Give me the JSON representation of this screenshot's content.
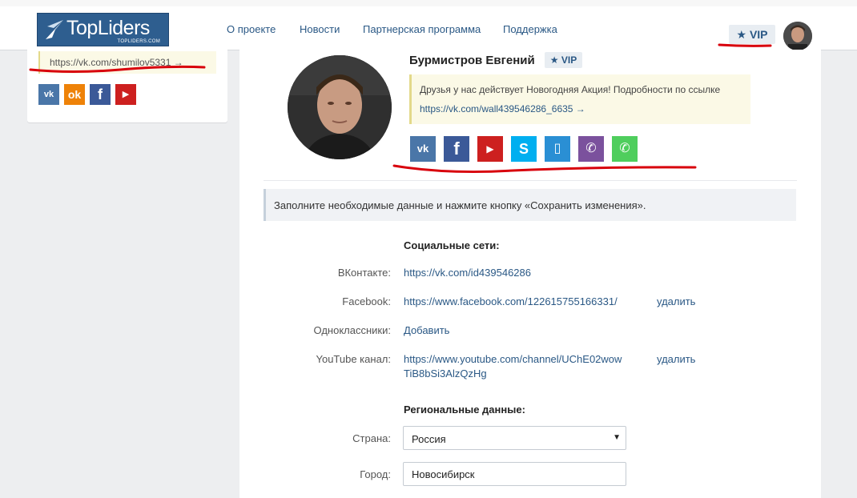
{
  "header": {
    "logo_text": "TopLiders",
    "logo_sub": "TOPLIDERS.COM",
    "nav": [
      "О проекте",
      "Новости",
      "Партнерская программа",
      "Поддержка"
    ],
    "vip_label": "VIP"
  },
  "sidebar": {
    "link": "https://vk.com/shumilov5331 →",
    "social_icons": [
      "vk-icon",
      "odnoklassniki-icon",
      "facebook-icon",
      "youtube-icon"
    ]
  },
  "profile": {
    "name": "Бурмистров Евгений",
    "vip_label": "VIP",
    "status_text": "Друзья у нас действует Новогодняя Акция! Подробности по ссылке",
    "status_link": "https://vk.com/wall439546286_6635 →",
    "social_icons": [
      "vk-icon",
      "facebook-icon",
      "youtube-icon",
      "skype-icon",
      "phone-icon",
      "viber-icon",
      "whatsapp-icon"
    ]
  },
  "notice": "Заполните необходимые данные и нажмите кнопку «Сохранить изменения».",
  "social": {
    "title": "Социальные сети:",
    "vk_label": "ВКонтакте:",
    "vk_value": "https://vk.com/id439546286",
    "fb_label": "Facebook:",
    "fb_value": "https://www.facebook.com/122615755166331/",
    "fb_delete": "удалить",
    "ok_label": "Одноклассники:",
    "ok_value": "Добавить",
    "yt_label": "YouTube канал:",
    "yt_value_line1": "https://www.youtube.com/channel/UChE02wow",
    "yt_value_line2": "TiB8bSi3AlzQzHg",
    "yt_delete": "удалить"
  },
  "regional": {
    "title": "Региональные данные:",
    "country_label": "Страна:",
    "country_value": "Россия",
    "city_label": "Город:",
    "city_value": "Новосибирск"
  },
  "colors": {
    "vk": "#4a76a8",
    "ok": "#ee8208",
    "facebook": "#3b5998",
    "youtube": "#cd201f",
    "skype": "#00aff0",
    "phone": "#2a8fd4",
    "viber": "#7b519d",
    "whatsapp": "#4fce5d",
    "annotation": "#d8000c"
  }
}
